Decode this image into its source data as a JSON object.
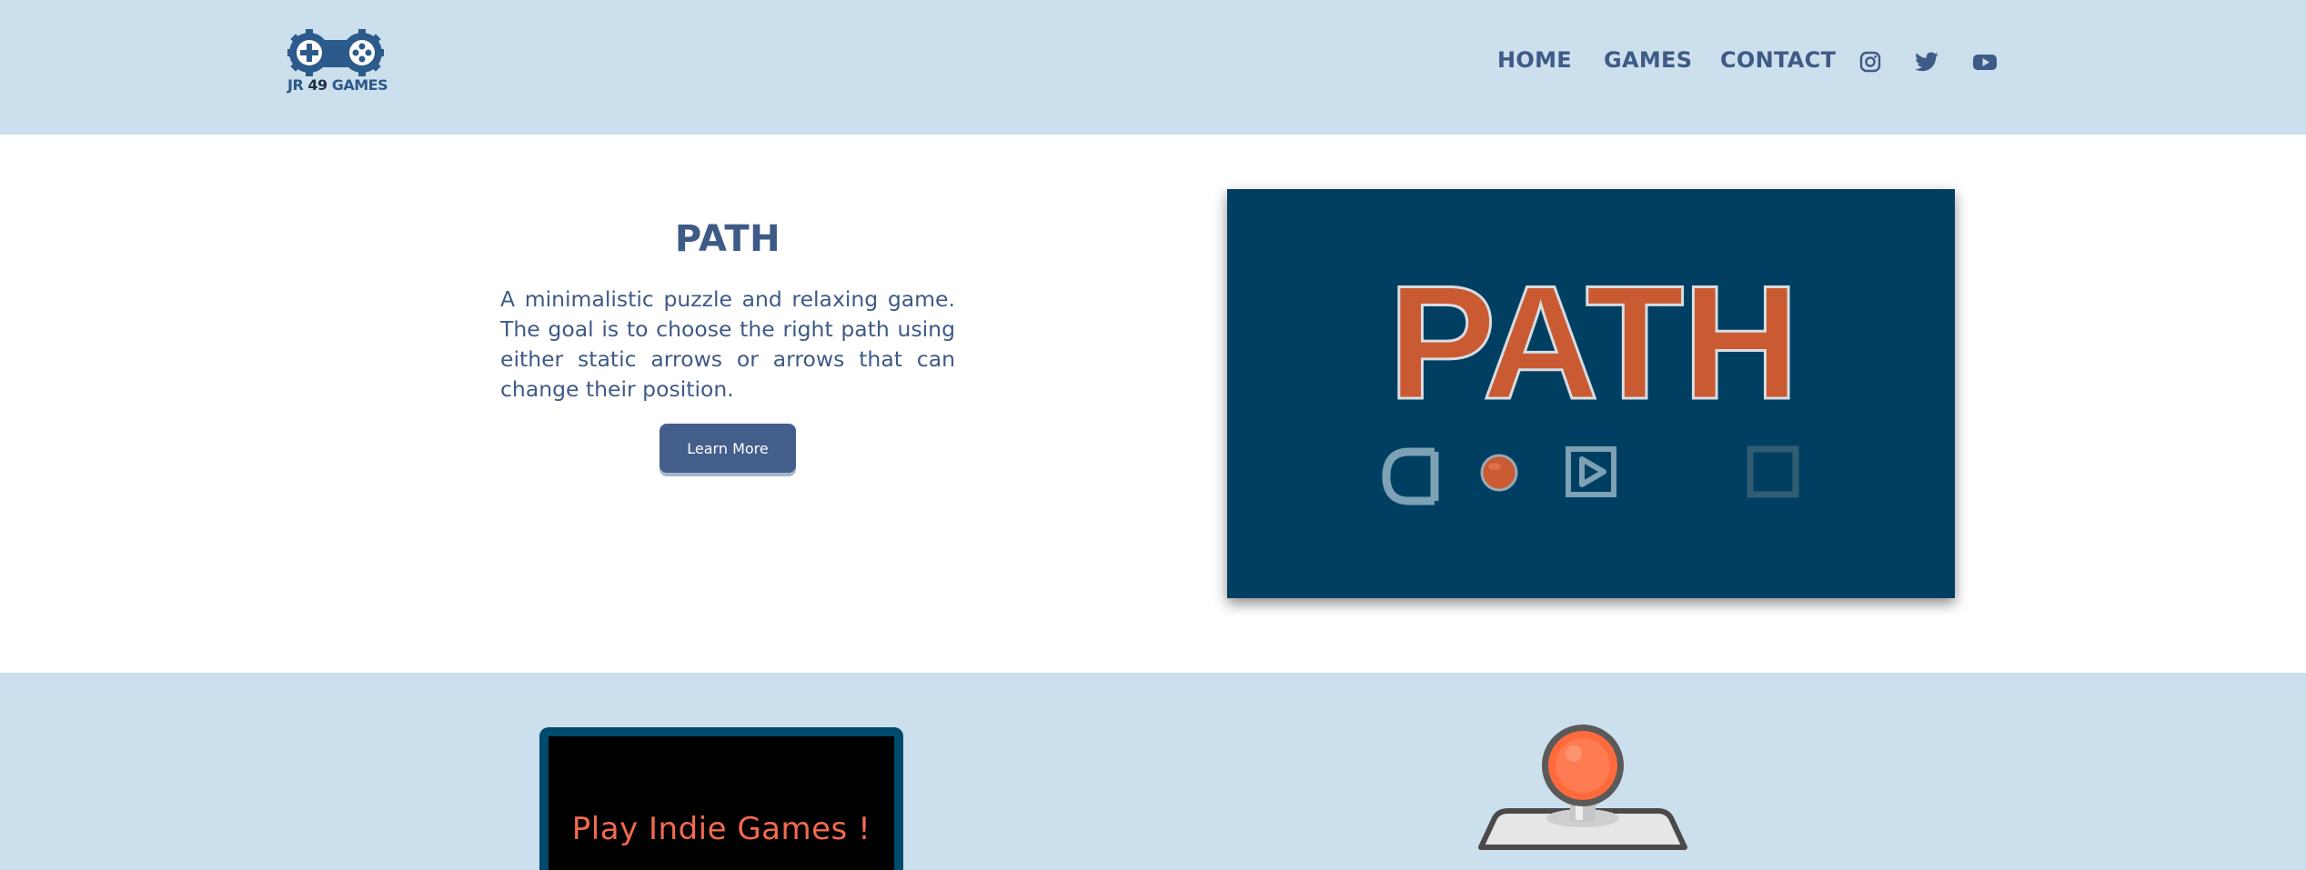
{
  "header": {
    "logo": {
      "icon": "gamepad-icon",
      "prefix": "JR",
      "number": "49",
      "suffix": "GAMES"
    },
    "nav": [
      {
        "label": "HOME"
      },
      {
        "label": "GAMES"
      },
      {
        "label": "CONTACT"
      }
    ],
    "social": [
      {
        "icon": "instagram-icon"
      },
      {
        "icon": "twitter-icon"
      },
      {
        "icon": "youtube-icon"
      }
    ]
  },
  "hero": {
    "title": "PATH",
    "description": "A minimalistic puzzle and relaxing game. The goal is to choose the right path using either static arrows or arrows that can change their position.",
    "button_label": "Learn More",
    "art": {
      "title": "PATH",
      "background": "#003f61",
      "title_color": "#c95a32"
    }
  },
  "lower": {
    "screen_text": "Play Indie Games !"
  },
  "colors": {
    "header_bg": "#ccdfed",
    "nav_text": "#3e5a86",
    "button_bg": "#435e8b",
    "accent_orange": "#f26a4f"
  }
}
